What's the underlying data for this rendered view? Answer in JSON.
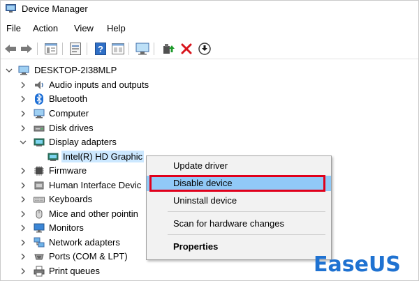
{
  "window": {
    "title": "Device Manager"
  },
  "menu": {
    "file": "File",
    "action": "Action",
    "view": "View",
    "help": "Help"
  },
  "toolbar": {
    "icons": [
      "back-arrow-icon",
      "forward-arrow-icon",
      "properties-pane-icon",
      "driver-details-icon",
      "help-icon",
      "view-pane-icon",
      "monitor-scan-icon",
      "update-driver-icon",
      "uninstall-x-icon",
      "download-circle-icon"
    ]
  },
  "tree": {
    "root": "DESKTOP-2I38MLP",
    "items": [
      {
        "label": "Audio inputs and outputs",
        "icon": "speaker-icon",
        "state": "collapsed"
      },
      {
        "label": "Bluetooth",
        "icon": "bluetooth-icon",
        "state": "collapsed"
      },
      {
        "label": "Computer",
        "icon": "computer-icon",
        "state": "collapsed"
      },
      {
        "label": "Disk drives",
        "icon": "disk-drive-icon",
        "state": "collapsed"
      },
      {
        "label": "Display adapters",
        "icon": "display-adapter-icon",
        "state": "expanded"
      },
      {
        "label": "Intel(R) HD Graphic",
        "icon": "display-adapter-icon",
        "state": "child-selected"
      },
      {
        "label": "Firmware",
        "icon": "firmware-icon",
        "state": "collapsed"
      },
      {
        "label": "Human Interface Devic",
        "icon": "hid-icon",
        "state": "collapsed"
      },
      {
        "label": "Keyboards",
        "icon": "keyboard-icon",
        "state": "collapsed"
      },
      {
        "label": "Mice and other pointin",
        "icon": "mouse-icon",
        "state": "collapsed"
      },
      {
        "label": "Monitors",
        "icon": "monitor-icon",
        "state": "collapsed"
      },
      {
        "label": "Network adapters",
        "icon": "network-adapter-icon",
        "state": "collapsed"
      },
      {
        "label": "Ports (COM & LPT)",
        "icon": "port-icon",
        "state": "collapsed"
      },
      {
        "label": "Print queues",
        "icon": "printer-icon",
        "state": "collapsed"
      }
    ]
  },
  "context_menu": {
    "items": [
      {
        "label": "Update driver"
      },
      {
        "label": "Disable device",
        "highlighted": true
      },
      {
        "label": "Uninstall device"
      },
      {
        "label": "Scan for hardware changes"
      },
      {
        "label": "Properties",
        "bold": true
      }
    ]
  },
  "watermark": {
    "text": "EaseUS"
  },
  "colors": {
    "highlight": "#91c9f7",
    "selection": "#cce8ff",
    "outline": "#e0001b",
    "brand": "#1f72d1"
  }
}
